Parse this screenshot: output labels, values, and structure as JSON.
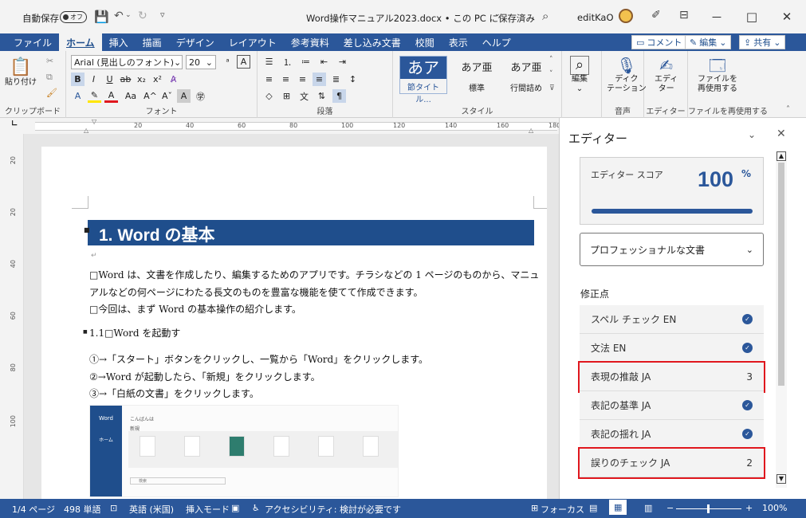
{
  "titlebar": {
    "autosave": "自動保存",
    "autosave_state": "オフ",
    "doc_title": "Word操作マニュアル2023.docx • この PC に保存済み",
    "user": "editKaO",
    "minimize": "－",
    "maximize": "□",
    "close": "✕"
  },
  "tabs": [
    "ファイル",
    "ホーム",
    "挿入",
    "描画",
    "デザイン",
    "レイアウト",
    "参考資料",
    "差し込み文書",
    "校閲",
    "表示",
    "ヘルプ"
  ],
  "tab_buttons": {
    "comment": "コメント",
    "edit": "編集",
    "share": "共有"
  },
  "ribbon": {
    "clipboard": {
      "paste": "貼り付け",
      "label": "クリップボード"
    },
    "font": {
      "name": "Arial (見出しのフォント)",
      "size": "20",
      "label": "フォント"
    },
    "paragraph": {
      "label": "段落"
    },
    "styles": {
      "label": "スタイル",
      "s1_preview": "あア",
      "s1_name": "節タイトル...",
      "s2_preview": "あア亜",
      "s2_name": "標準",
      "s3_preview": "あア亜",
      "s3_name": "行間詰め"
    },
    "editing": {
      "label": "編集"
    },
    "voice": {
      "dictate": "ディク\nテーション",
      "label": "音声"
    },
    "editor": {
      "name": "エディ\nター",
      "label": "エディター"
    },
    "reuse": {
      "name": "ファイルを\n再使用する",
      "label": "ファイルを再使用する"
    }
  },
  "ruler": {
    "marks": [
      "20",
      "40",
      "60",
      "80",
      "100",
      "120",
      "140",
      "160",
      "180"
    ]
  },
  "vruler": {
    "marks": [
      "20",
      "20",
      "40",
      "60",
      "80",
      "100"
    ]
  },
  "document": {
    "heading": "1. Word の基本",
    "p1": "□Word は、文書を作成したり、編集するためのアプリです。チラシなどの 1 ページのものから、マニュ",
    "p2": "アルなどの何ページにわたる長文のものを豊富な機能を使てて作成できます。",
    "p3": "□今回は、まず Word の基本操作の紹介します。",
    "sub": "1.1□Word を起動す",
    "step1": "①→「スタート」ボタンをクリックし、一覧から「Word」をクリックします。",
    "step2": "②→Word が起動したら、「新規」をクリックします。",
    "step3": "③→「白紙の文書」をクリックします。",
    "screenshot": {
      "app": "Word",
      "greet": "こんばんは",
      "new": "新規",
      "home": "ホーム",
      "search": "検索"
    }
  },
  "editor_pane": {
    "title": "エディター",
    "score_label": "エディター スコア",
    "score": "100",
    "score_unit": "%",
    "score_fraction": 1.0,
    "dropdown": "プロフェッショナルな文書",
    "corrections_label": "修正点",
    "rows": [
      {
        "label": "スペル チェック  EN",
        "status": "check"
      },
      {
        "label": "文法  EN",
        "status": "check"
      },
      {
        "label": "表現の推敲  JA",
        "count": "3"
      },
      {
        "label": "表記の基準  JA",
        "status": "check"
      },
      {
        "label": "表記の揺れ  JA",
        "status": "check"
      },
      {
        "label": "誤りのチェック  JA",
        "count": "2"
      }
    ]
  },
  "statusbar": {
    "page": "1/4 ページ",
    "words": "498 単語",
    "lang": "英語 (米国)",
    "mode": "挿入モード",
    "access": "アクセシビリティ: 検討が必要です",
    "focus": "フォーカス",
    "zoom": "100%"
  },
  "colors": {
    "accent": "#2b579a",
    "heading_bg": "#1f4e8c",
    "highlight": "#e0171e"
  }
}
